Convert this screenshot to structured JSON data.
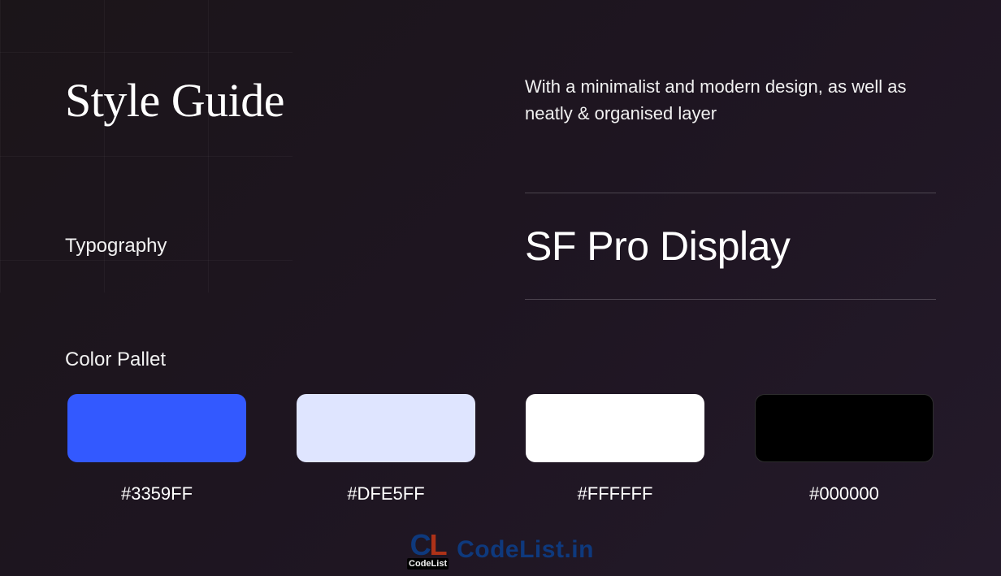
{
  "title": "Style Guide",
  "description": "With a minimalist and modern design, as well as neatly & organised layer",
  "typography": {
    "label": "Typography",
    "font": "SF Pro Display"
  },
  "palette": {
    "label": "Color Pallet",
    "colors": [
      {
        "hex": "#3359FF",
        "outlined": false
      },
      {
        "hex": "#DFE5FF",
        "outlined": false
      },
      {
        "hex": "#FFFFFF",
        "outlined": false
      },
      {
        "hex": "#000000",
        "outlined": true
      }
    ]
  },
  "watermark": {
    "badge_sub": "CodeList",
    "text": "CodeList.in"
  }
}
